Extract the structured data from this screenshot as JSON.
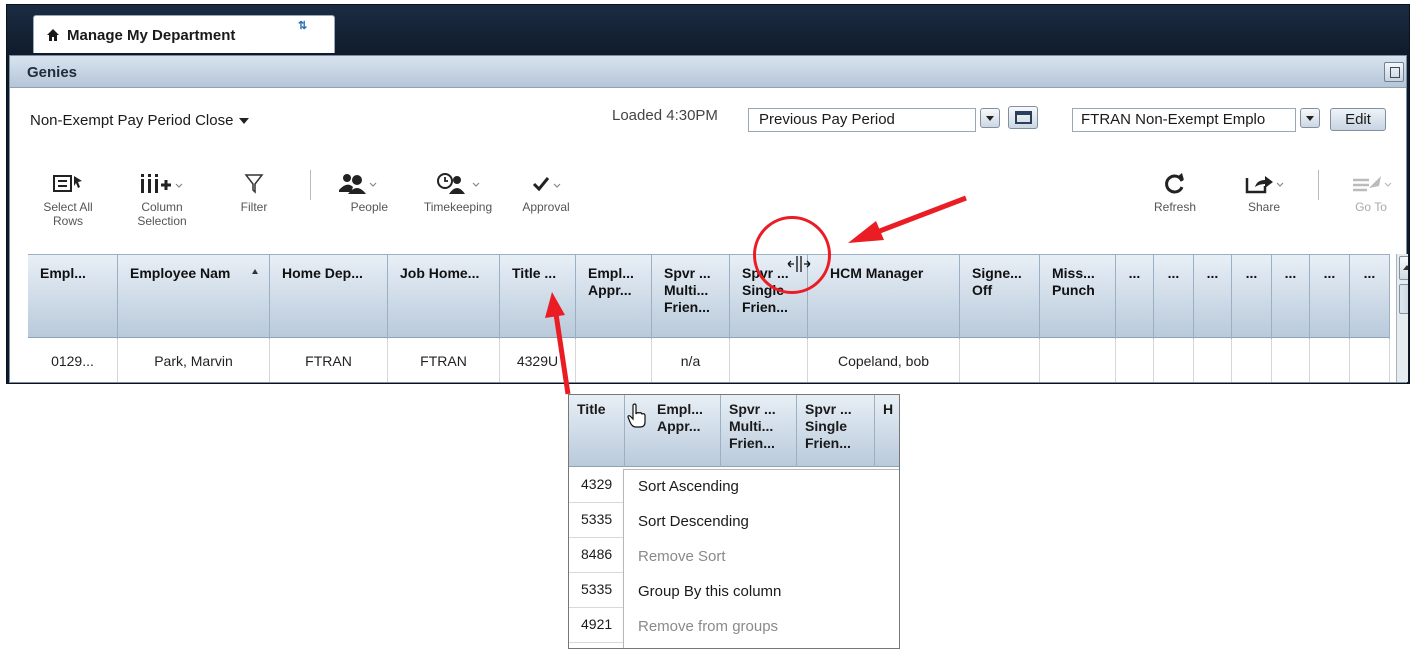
{
  "tab": {
    "title": "Manage My Department"
  },
  "panel": {
    "title": "Genies"
  },
  "genie_select": {
    "value": "Non-Exempt Pay Period Close"
  },
  "loaded": "Loaded 4:30PM",
  "period_select": {
    "value": "Previous Pay Period"
  },
  "hyperfind_select": {
    "value": "FTRAN Non-Exempt Emplo"
  },
  "edit_label": "Edit",
  "toolbar": {
    "select_all": [
      "Select All",
      "Rows"
    ],
    "column_selection": [
      "Column",
      "Selection"
    ],
    "filter": "Filter",
    "people": "People",
    "timekeeping": "Timekeeping",
    "approval": "Approval",
    "refresh": "Refresh",
    "share": "Share",
    "goto": "Go To"
  },
  "grid": {
    "headers": [
      [
        "Empl..."
      ],
      [
        "Employee Nam"
      ],
      [
        "Home Dep..."
      ],
      [
        "Job Home..."
      ],
      [
        "Title ..."
      ],
      [
        "Empl...",
        "Appr..."
      ],
      [
        "Spvr ...",
        "Multi...",
        "Frien..."
      ],
      [
        "Spvr ...",
        "Single",
        "Frien..."
      ],
      [
        "HCM Manager"
      ],
      [
        "Signe...",
        "Off"
      ],
      [
        "Miss...",
        "Punch"
      ],
      [
        "..."
      ],
      [
        "..."
      ],
      [
        "..."
      ],
      [
        "..."
      ],
      [
        "..."
      ],
      [
        "..."
      ],
      [
        "..."
      ]
    ],
    "row": [
      "0129...",
      "Park, Marvin",
      "FTRAN",
      "FTRAN",
      "4329U",
      "",
      "n/a",
      "",
      "Copeland, bob",
      "",
      "",
      "",
      "",
      "",
      "",
      "",
      "",
      ""
    ]
  },
  "zoom": {
    "headers": [
      [
        "Title"
      ],
      [
        "Empl...",
        "Appr..."
      ],
      [
        "Spvr ...",
        "Multi...",
        "Frien..."
      ],
      [
        "Spvr ...",
        "Single",
        "Frien..."
      ],
      [
        "H"
      ]
    ],
    "rows": [
      "4329",
      "5335",
      "8486",
      "5335",
      "4921"
    ],
    "menu": [
      {
        "label": "Sort Ascending",
        "enabled": true
      },
      {
        "label": "Sort Descending",
        "enabled": true
      },
      {
        "label": "Remove Sort",
        "enabled": false
      },
      {
        "label": "Group By this column",
        "enabled": true
      },
      {
        "label": "Remove from groups",
        "enabled": false
      }
    ]
  },
  "colors": {
    "annotation": "#ea1c24",
    "header_bg": "#b9cadb",
    "frame": "#0e1a2a"
  }
}
